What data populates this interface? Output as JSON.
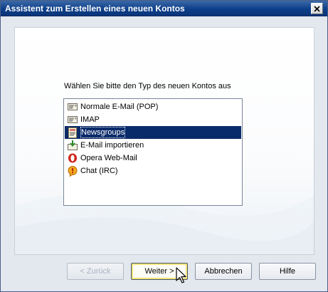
{
  "window": {
    "title": "Assistent zum Erstellen eines neuen Kontos"
  },
  "main": {
    "prompt": "Wählen Sie bitte den Typ des neuen Kontos aus",
    "account_types": [
      {
        "label": "Normale E-Mail (POP)",
        "icon": "mail-pop-icon",
        "selected": false
      },
      {
        "label": "IMAP",
        "icon": "mail-imap-icon",
        "selected": false
      },
      {
        "label": "Newsgroups",
        "icon": "newsgroups-icon",
        "selected": true
      },
      {
        "label": "E-Mail importieren",
        "icon": "import-mail-icon",
        "selected": false
      },
      {
        "label": "Opera Web-Mail",
        "icon": "opera-icon",
        "selected": false
      },
      {
        "label": "Chat (IRC)",
        "icon": "chat-icon",
        "selected": false
      }
    ]
  },
  "buttons": {
    "back": "< Zurück",
    "next": "Weiter >",
    "cancel": "Abbrechen",
    "help": "Hilfe"
  },
  "colors": {
    "titlebar": "#0d3f8a",
    "selection": "#0a2b6a",
    "dialog_background": "#e3e8ef"
  }
}
